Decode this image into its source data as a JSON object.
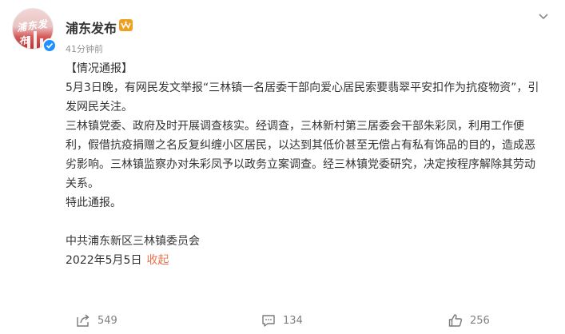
{
  "post": {
    "author": "浦东发布",
    "avatar_text": "浦东发布",
    "time": "41分钟前",
    "paragraphs": {
      "title": "【情况通报】",
      "p1": "5月3日晚，有网民发文举报“三林镇一名居委干部向爱心居民索要翡翠平安扣作为抗疫物资”，引发网民关注。",
      "p2": "三林镇党委、政府及时开展调查核实。经调查，三林新村第三居委会干部朱彩凤，利用工作便利，假借抗疫捐赠之名反复纠缠小区居民，以达到其低价甚至无偿占有私有饰品的目的，造成恶劣影响。三林镇监察办对朱彩凤予以政务立案调查。经三林镇党委研究，决定按程序解除其劳动关系。",
      "p3": "特此通报。",
      "signature": "中共浦东新区三林镇委员会",
      "date": "2022年5月5日",
      "collapse": "收起"
    }
  },
  "actions": {
    "share_count": "549",
    "comment_count": "134",
    "like_count": "256"
  },
  "colors": {
    "accent": "#eb7350",
    "verify": "#1e90ff",
    "vip": "#f0a020",
    "muted": "#939393"
  },
  "icons": {
    "more": "chevron-down-icon",
    "share": "share-icon",
    "comment": "comment-icon",
    "like": "thumbs-up-icon",
    "verify": "verified-badge-icon",
    "vip": "vip-badge-icon"
  }
}
